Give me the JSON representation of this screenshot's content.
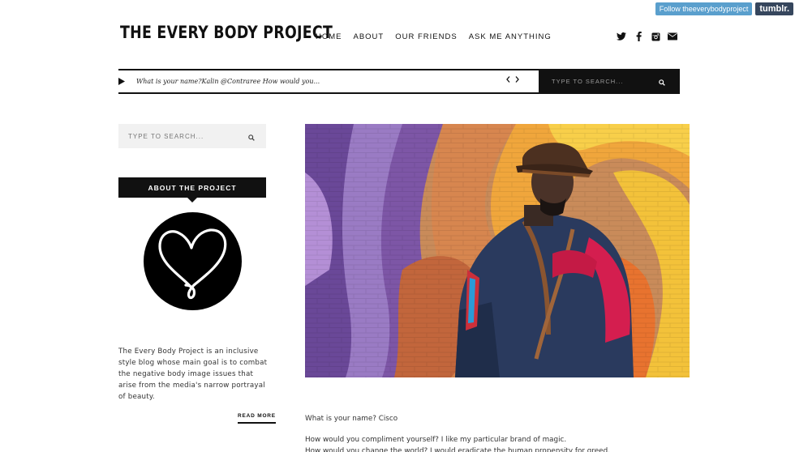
{
  "tumblr": {
    "follow_label": "Follow theeverybodyproject",
    "logo_label": "tumblr."
  },
  "header": {
    "site_title": "THE EVERY BODY PROJECT",
    "nav": [
      "HOME",
      "ABOUT",
      "OUR FRIENDS",
      "ASK ME ANYTHING"
    ],
    "social_icons": [
      "twitter-icon",
      "facebook-icon",
      "instagram-icon",
      "email-icon"
    ]
  },
  "ticker": {
    "text": "What is your name?Kalin @Contraree How would you...",
    "search_placeholder": "TYPE TO SEARCH..."
  },
  "sidebar": {
    "search_placeholder": "TYPE TO SEARCH...",
    "about_label": "ABOUT THE PROJECT",
    "about_text": "The Every Body Project is an inclusive style blog whose main goal is to combat the negative body image issues that arise from the media's narrow portrayal of beauty.",
    "read_more": "READ MORE"
  },
  "post": {
    "lines": [
      "What is your name? Cisco",
      "How would you compliment yourself? I like my particular brand of magic.",
      "How would you change the world? I would eradicate the human propensity for greed."
    ]
  },
  "colors": {
    "black": "#111111",
    "tumblr_blue": "#5a9fcd",
    "tumblr_dark": "#36465d",
    "search_bg": "#f1f1f1"
  }
}
